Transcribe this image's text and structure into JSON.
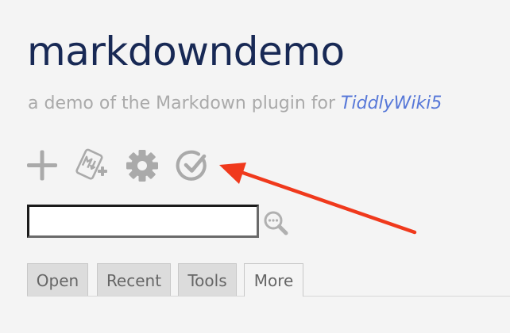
{
  "site": {
    "title": "markdowndemo",
    "subtitle_prefix": "a demo of the Markdown plugin for ",
    "subtitle_link": "TiddlyWiki5"
  },
  "toolbar": {
    "buttons": [
      {
        "name": "new-tiddler-button",
        "icon": "plus-icon"
      },
      {
        "name": "new-markdown-tiddler-button",
        "icon": "markdown-plus-icon"
      },
      {
        "name": "control-panel-button",
        "icon": "gear-icon"
      },
      {
        "name": "save-wiki-button",
        "icon": "check-circle-icon"
      }
    ],
    "icon_color": "#aaaaaa"
  },
  "search": {
    "value": "",
    "placeholder": "",
    "icon": "search-icon"
  },
  "tabs": {
    "items": [
      {
        "label": "Open",
        "selected": false
      },
      {
        "label": "Recent",
        "selected": false
      },
      {
        "label": "Tools",
        "selected": false
      },
      {
        "label": "More",
        "selected": true
      }
    ]
  },
  "annotation": {
    "arrow_color": "#f0391c",
    "arrow_icon": "red-arrow-icon"
  },
  "colors": {
    "title": "#182955",
    "subtitle": "#aaaaaa",
    "link": "#5778d8",
    "background": "#f4f4f4"
  }
}
